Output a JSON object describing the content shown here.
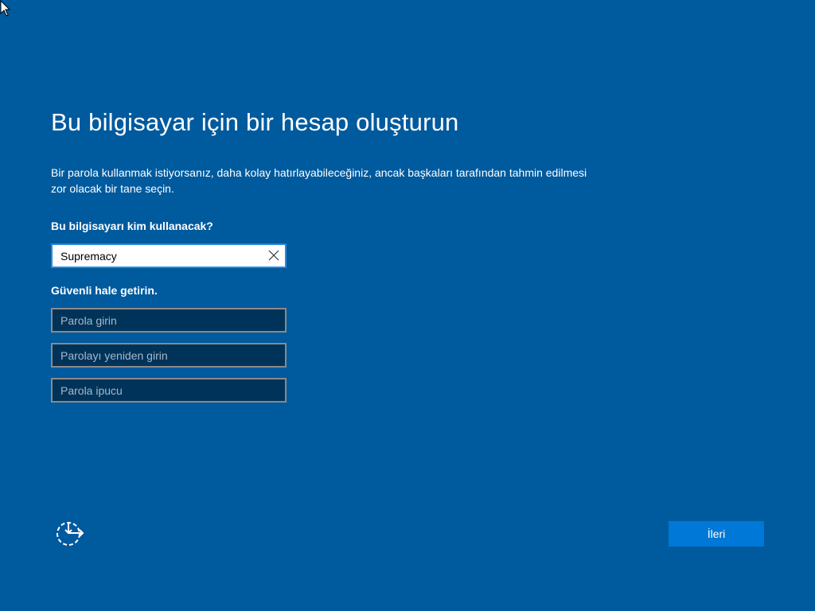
{
  "page": {
    "title": "Bu bilgisayar için bir hesap oluşturun",
    "description": "Bir parola kullanmak istiyorsanız, daha kolay hatırlayabileceğiniz, ancak başkaları tarafından tahmin edilmesi zor olacak bir tane seçin.",
    "background_color": "#005a9e"
  },
  "account": {
    "question_label": "Bu bilgisayarı kim kullanacak?",
    "username_value": "Supremacy",
    "clear_icon": "close-icon"
  },
  "security": {
    "label": "Güvenli hale getirin.",
    "password_placeholder": "Parola girin",
    "password_confirm_placeholder": "Parolayı yeniden girin",
    "password_hint_placeholder": "Parola ipucu"
  },
  "footer": {
    "accessibility_icon": "ease-of-access-icon",
    "next_label": "İleri",
    "next_color": "#0078d7"
  }
}
